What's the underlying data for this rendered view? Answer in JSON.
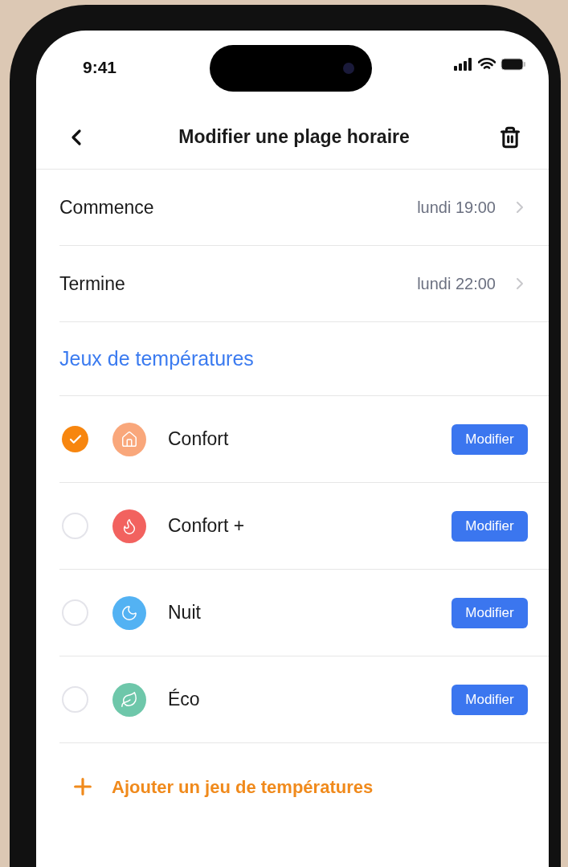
{
  "status_bar": {
    "time": "9:41"
  },
  "header": {
    "title": "Modifier une plage horaire"
  },
  "schedule": [
    {
      "label": "Commence",
      "value": "lundi 19:00"
    },
    {
      "label": "Termine",
      "value": "lundi 22:00"
    }
  ],
  "section_title": "Jeux de températures",
  "temperature_sets": [
    {
      "name": "Confort",
      "kind": "home",
      "color": "#f9a77b",
      "selected": true,
      "button": "Modifier"
    },
    {
      "name": "Confort +",
      "kind": "flame",
      "color": "#f2625f",
      "selected": false,
      "button": "Modifier"
    },
    {
      "name": "Nuit",
      "kind": "moon",
      "color": "#53b2f3",
      "selected": false,
      "button": "Modifier"
    },
    {
      "name": "Éco",
      "kind": "leaf",
      "color": "#6ec7aa",
      "selected": false,
      "button": "Modifier"
    }
  ],
  "add_button": "Ajouter un jeu de températures"
}
